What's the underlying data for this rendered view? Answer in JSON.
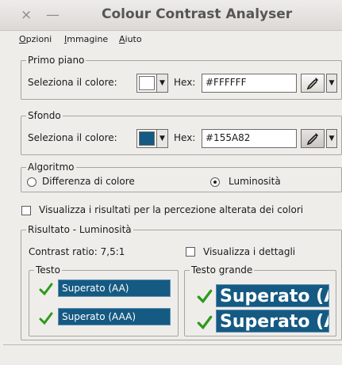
{
  "window": {
    "title": "Colour Contrast Analyser",
    "close_glyph": "×",
    "minimize_glyph": "—"
  },
  "menu": [
    {
      "label": "Opzioni",
      "accel": "O",
      "rest": "pzioni"
    },
    {
      "label": "Immagine",
      "accel": "I",
      "rest": "mmagine"
    },
    {
      "label": "Aiuto",
      "accel": "A",
      "rest": "iuto"
    }
  ],
  "foreground": {
    "legend": "Primo piano",
    "select_label": "Seleziona il colore:",
    "hex_label": "Hex:",
    "hex_value": "#FFFFFF",
    "color": "#ffffff"
  },
  "background": {
    "legend": "Sfondo",
    "select_label": "Seleziona il colore:",
    "hex_label": "Hex:",
    "hex_value": "#155A82",
    "color": "#155a82"
  },
  "algorithm": {
    "legend": "Algoritmo",
    "options": [
      "Differenza di colore",
      "Luminosità"
    ],
    "selected": "Luminosità"
  },
  "altered_perception": {
    "label": "Visualizza i risultati per la percezione alterata dei colori",
    "checked": false
  },
  "result": {
    "legend": "Risultato - Luminosità",
    "contrast_ratio": "Contrast ratio: 7,5:1",
    "details_label": "Visualizza i dettagli",
    "details_checked": false,
    "text_group": {
      "legend": "Testo",
      "aa": "Superato (AA)",
      "aaa": "Superato (AAA)"
    },
    "large_text_group": {
      "legend": "Testo grande",
      "aa": "Superato (AA)",
      "aaa": "Superato (AAA)"
    },
    "pass_color": "#2e9a1e"
  }
}
